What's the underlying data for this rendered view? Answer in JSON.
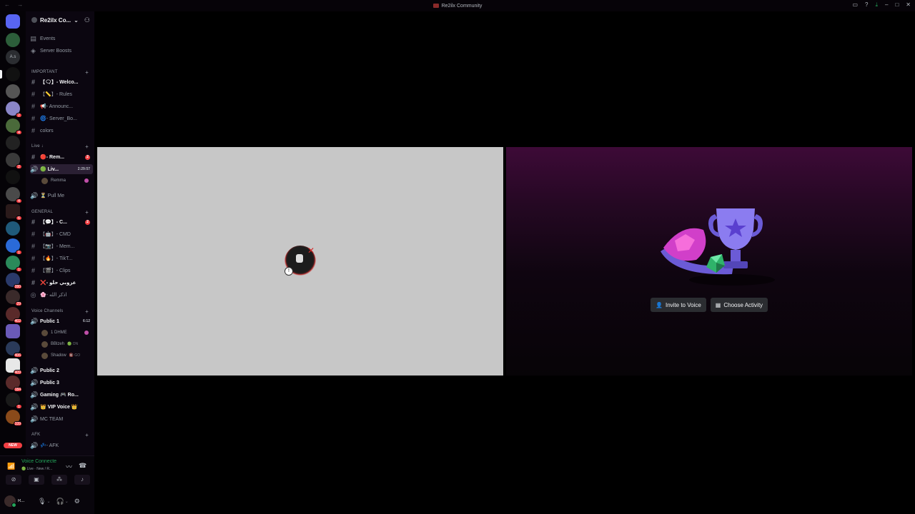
{
  "window": {
    "title": "Re2ilx Community",
    "nav": "← →"
  },
  "server": {
    "name": "Re2ilx Co..."
  },
  "nav_items": [
    {
      "label": "Events",
      "icon": "calendar-icon"
    },
    {
      "label": "Server Boosts",
      "icon": "boost-icon"
    }
  ],
  "categories": {
    "important": "IMPORTANT",
    "live": "Live ↓",
    "general": "GENERAL",
    "voice": "Voice Channels",
    "afk": "AFK"
  },
  "channels": {
    "welcome": "【🗨】- Welco...",
    "rules": "【📏】- Rules",
    "announce": "📢- Announc...",
    "server_boost": "🌀- Server_Bo...",
    "colors": "colors",
    "rem": "🔴- Rem...",
    "live": "🟢 Liv...",
    "live_time": "2:29:57",
    "rem_badge": "2",
    "pull_me": "⏳ Pull Me",
    "chat": "【💬】- C...",
    "chat_badge": "2",
    "cmd": "【🤖】- CMD",
    "memes": "【📷】- Mem...",
    "tiktok": "【🔥】- TikT...",
    "clips": "【🎬】- Clips",
    "arabic1": "❌- عزوبي حلو",
    "arabic2": "🌸- اذكر الله",
    "public1": "Public 1",
    "public1_time": "6:12",
    "public2": "Public 2",
    "public3": "Public 3",
    "gaming": "Gaming 🎮 Ro...",
    "vip": "👑 VIP Voice 👑",
    "mc_team": "MC TEAM",
    "afk": "💤- AFK"
  },
  "members": {
    "live_member": "Remma",
    "p1_a": "1 DHME",
    "p1_b": "BBlzeh",
    "p1_b_tag": "🟢 ON",
    "p1_c": "Shadow",
    "p1_c_tag": "🔇 GO"
  },
  "rail_badges": [
    "2",
    "4",
    "2",
    "4",
    "6",
    "1",
    "1",
    "1",
    "1",
    "280",
    "29",
    "402",
    "406",
    "409",
    "184",
    "1",
    "339"
  ],
  "rail_new": "NEW",
  "voice_panel": {
    "status": "Voice Connecte",
    "channel": "🟢 Live · New / R...",
    "username": "R..."
  },
  "stage": {
    "invite_label": "Invite to Voice",
    "activity_label": "Choose Activity"
  }
}
